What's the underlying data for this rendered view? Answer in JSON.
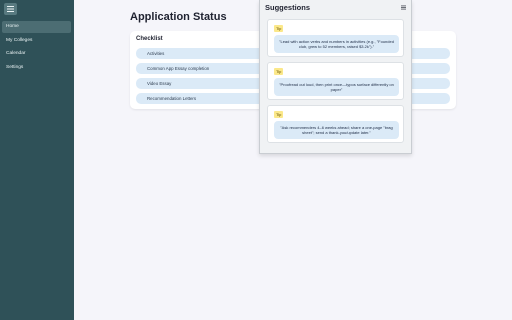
{
  "sidebar": {
    "menu_icon": "hamburger-icon",
    "items": [
      {
        "label": "Home",
        "active": true
      },
      {
        "label": "My Colleges",
        "active": false
      },
      {
        "label": "Calendar",
        "active": false
      },
      {
        "label": "Settings",
        "active": false
      }
    ]
  },
  "main": {
    "title": "Application Status",
    "checklist": {
      "title": "Checklist",
      "items": [
        "Activities",
        "Common App Essay completion",
        "Video Essay",
        "Recommendation Letters"
      ]
    }
  },
  "suggestions": {
    "title": "Suggestions",
    "menu_icon": "hamburger-icon",
    "tips": [
      {
        "badge": "Tip",
        "text": "\"Lead with action verbs and numbers in activities (e.g., \"Founded club, grew to 52 members, raised $3.2k\").\""
      },
      {
        "badge": "Tip",
        "text": "\"Proofread out loud, then print once—typos surface differently on paper\""
      },
      {
        "badge": "Tip",
        "text": "\"Ask recommenders 4–6 weeks ahead; share a one-page \"brag sheet\"; send a thank-you/update later.\""
      }
    ]
  },
  "colors": {
    "sidebar_bg": "#2f5158",
    "sidebar_active": "#4c6d73",
    "item_bg": "#dbeaf7",
    "badge_bg": "#fbe88a",
    "page_bg": "#f5f5fa"
  }
}
